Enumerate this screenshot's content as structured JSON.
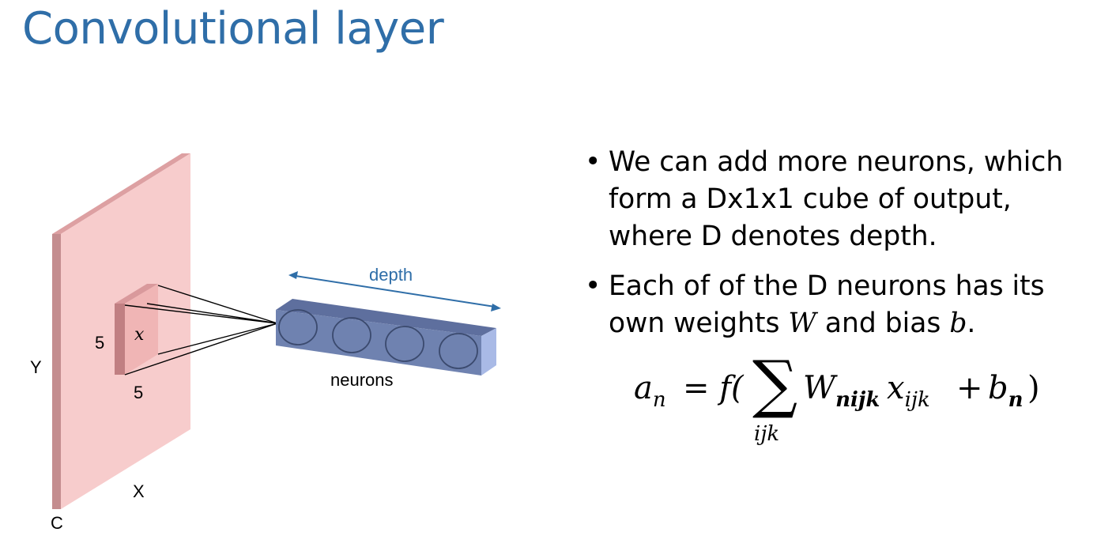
{
  "slide": {
    "title": "Convolutional layer"
  },
  "diagram": {
    "input_height_label": "Y",
    "input_width_label": "X",
    "input_channels_label": "C",
    "receptive_field_height": "5",
    "receptive_field_width": "5",
    "receptive_field_symbol": "x",
    "depth_label": "depth",
    "neurons_label": "neurons",
    "neuron_count": 4,
    "colors": {
      "input_front": "#f7cccc",
      "input_side": "#c48d8f",
      "input_top": "#dda0a2",
      "field_front": "#f0b5b5",
      "field_side": "#c07f82",
      "neuron_front": "#6f82b0",
      "neuron_top": "#5e6f9e",
      "neuron_end": "#a9bae6",
      "depth_arrow": "#2f6ea8"
    }
  },
  "bullets": {
    "marker": "•",
    "item1": "We can add more neurons, which form a Dx1x1 cube of output, where D denotes depth.",
    "item2_text": "Each of of the D neurons has its own weights ",
    "item2_weight_symbol": "W",
    "item2_mid": " and bias ",
    "item2_bias_symbol": "b",
    "item2_end": "."
  },
  "formula": {
    "lhs_var": "a",
    "lhs_sub": "n",
    "equals_f": "= f(",
    "sum_symbol": "∑",
    "sum_index": "ijk",
    "weight_var": "W",
    "weight_sub": "nijk",
    "input_var": "x",
    "input_sub": "ijk",
    "plus": "+",
    "bias_var": "b",
    "bias_sub": "n",
    "close_paren": ")"
  }
}
